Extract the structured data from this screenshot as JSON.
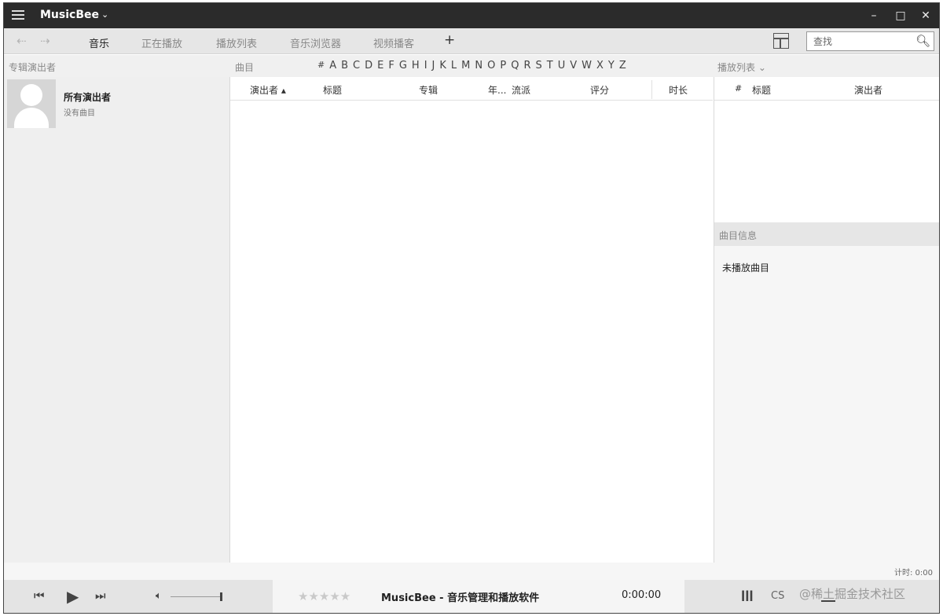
{
  "titlebar": {
    "app_title": "MusicBee",
    "chevron": "⌄",
    "minimize": "–",
    "maximize": "□",
    "close": "✕"
  },
  "toolbar": {
    "back_icon": "⇠",
    "forward_icon": "⇢",
    "tabs": [
      {
        "label": "音乐",
        "active": true
      },
      {
        "label": "正在播放",
        "active": false
      },
      {
        "label": "播放列表",
        "active": false
      },
      {
        "label": "音乐浏览器",
        "active": false
      },
      {
        "label": "视频播客",
        "active": false
      }
    ],
    "add_tab": "+",
    "search_placeholder": "查找",
    "search_icon": "🔍︎"
  },
  "section_bar": {
    "left_label": "专辑演出者",
    "center_label": "曲目",
    "alphabet": [
      "#",
      "A",
      "B",
      "C",
      "D",
      "E",
      "F",
      "G",
      "H",
      "I",
      "J",
      "K",
      "L",
      "M",
      "N",
      "O",
      "P",
      "Q",
      "R",
      "S",
      "T",
      "U",
      "V",
      "W",
      "X",
      "Y",
      "Z"
    ],
    "right_label": "播放列表  ⌄"
  },
  "left_panel": {
    "artist_name": "所有演出者",
    "artist_sub": "没有曲目"
  },
  "track_list": {
    "columns": [
      "演出者 ▴",
      "标题",
      "专辑",
      "年...",
      "流派",
      "评分",
      "时长"
    ]
  },
  "right_panel": {
    "columns": [
      "#",
      "标题",
      "演出者"
    ],
    "info_header": "曲目信息",
    "info_body": "未播放曲目"
  },
  "status": {
    "total": "计时: 0:00"
  },
  "player": {
    "prev_icon": "⏮",
    "play_icon": "▶",
    "next_icon": "⏭",
    "volume_icon": "🔈︎",
    "volume_level": 0.98,
    "rating_stars": "★★★★★",
    "now_playing": "MusicBee - 音乐管理和播放软件",
    "time": "0:00:00",
    "eq_icon": "ǀǀǀ",
    "scrobble_icon": "CS",
    "watermark": "@稀土掘金技术社区"
  }
}
